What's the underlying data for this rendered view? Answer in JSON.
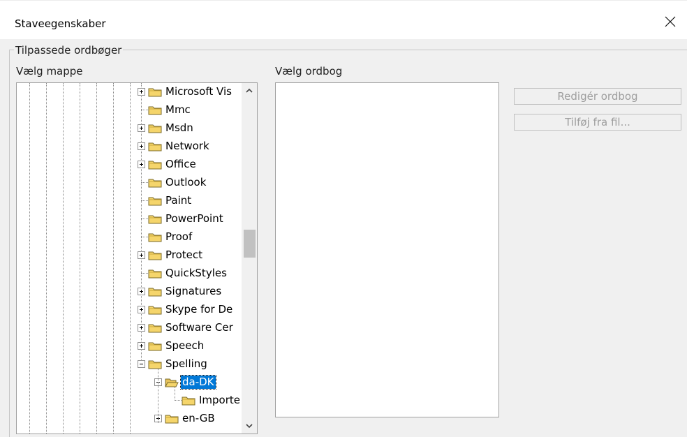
{
  "window": {
    "title": "Staveegenskaber",
    "close_icon": "close-icon"
  },
  "group": {
    "title": "Tilpassede ordbøger"
  },
  "folder_label": "Vælg mappe",
  "dictionary_label": "Vælg ordbog",
  "tree": {
    "nodes": [
      {
        "label": "Microsoft Vis",
        "level": 0,
        "expander": "plus"
      },
      {
        "label": "Mmc",
        "level": 0,
        "expander": "none"
      },
      {
        "label": "Msdn",
        "level": 0,
        "expander": "plus"
      },
      {
        "label": "Network",
        "level": 0,
        "expander": "plus"
      },
      {
        "label": "Office",
        "level": 0,
        "expander": "plus"
      },
      {
        "label": "Outlook",
        "level": 0,
        "expander": "none"
      },
      {
        "label": "Paint",
        "level": 0,
        "expander": "none"
      },
      {
        "label": "PowerPoint",
        "level": 0,
        "expander": "none"
      },
      {
        "label": "Proof",
        "level": 0,
        "expander": "none"
      },
      {
        "label": "Protect",
        "level": 0,
        "expander": "plus"
      },
      {
        "label": "QuickStyles",
        "level": 0,
        "expander": "none"
      },
      {
        "label": "Signatures",
        "level": 0,
        "expander": "plus"
      },
      {
        "label": "Skype for De",
        "level": 0,
        "expander": "plus"
      },
      {
        "label": "Software Cer",
        "level": 0,
        "expander": "plus"
      },
      {
        "label": "Speech",
        "level": 0,
        "expander": "plus"
      },
      {
        "label": "Spelling",
        "level": 0,
        "expander": "minus"
      },
      {
        "label": "da-DK",
        "level": 1,
        "expander": "minus",
        "selected": true,
        "open": true
      },
      {
        "label": "Importe",
        "level": 2,
        "expander": "none"
      },
      {
        "label": "en-GB",
        "level": 1,
        "expander": "plus"
      }
    ],
    "scroll_position": 0.45
  },
  "buttons": {
    "edit_dictionary": "Redigér ordbog",
    "add_from_file": "Tilføj fra fil..."
  },
  "colors": {
    "selection": "#0078d7",
    "folder": "#f5d56b"
  }
}
